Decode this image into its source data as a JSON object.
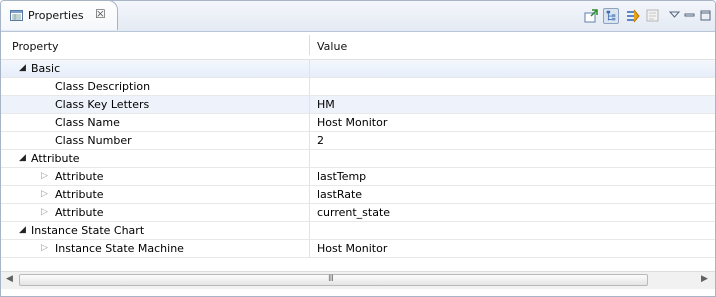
{
  "view": {
    "tab_label": "Properties",
    "tab_close": "☒"
  },
  "columns": {
    "property": "Property",
    "value": "Value"
  },
  "rows": [
    {
      "label": "Basic",
      "value": "",
      "indent": 0,
      "toggle": "open"
    },
    {
      "label": "Class Description",
      "value": "",
      "indent": 2,
      "toggle": "none"
    },
    {
      "label": "Class Key Letters",
      "value": "HM",
      "indent": 2,
      "toggle": "none"
    },
    {
      "label": "Class Name",
      "value": "Host Monitor",
      "indent": 2,
      "toggle": "none"
    },
    {
      "label": "Class Number",
      "value": "2",
      "indent": 2,
      "toggle": "none"
    },
    {
      "label": "Attribute",
      "value": "",
      "indent": 0,
      "toggle": "open"
    },
    {
      "label": "Attribute",
      "value": "lastTemp",
      "indent": 1,
      "toggle": "closed"
    },
    {
      "label": "Attribute",
      "value": "lastRate",
      "indent": 1,
      "toggle": "closed"
    },
    {
      "label": "Attribute",
      "value": "current_state",
      "indent": 1,
      "toggle": "closed"
    },
    {
      "label": "Instance State Chart",
      "value": "",
      "indent": 0,
      "toggle": "open"
    },
    {
      "label": "Instance State Machine",
      "value": "Host Monitor",
      "indent": 1,
      "toggle": "closed"
    }
  ],
  "scroll": {
    "left_arrow": "◀",
    "right_arrow": "▶",
    "grip": "III"
  },
  "toolbar": {
    "icons": [
      "pin-editor-icon",
      "categories-icon",
      "filter-advanced-icon",
      "restore-default-icon",
      "view-menu-icon",
      "minimize-icon",
      "maximize-icon"
    ]
  },
  "colors": {
    "accent": "#dbe5f1",
    "border": "#a7b4c6"
  }
}
